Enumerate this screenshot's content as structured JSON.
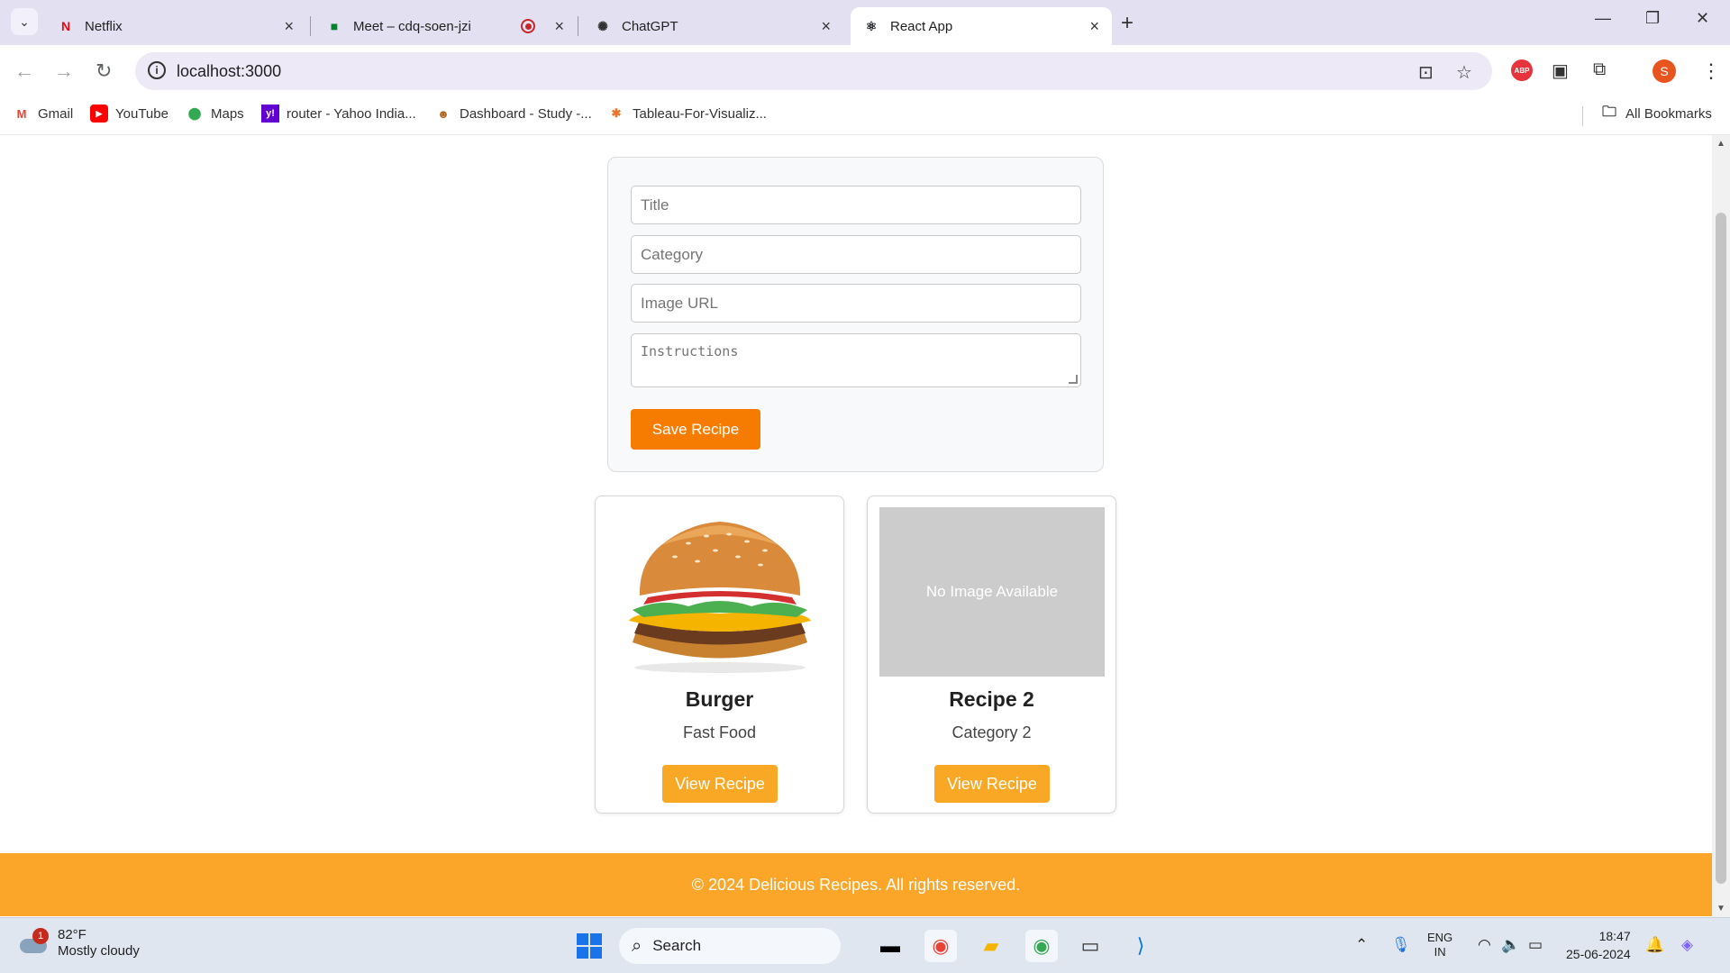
{
  "browser": {
    "tabs": [
      {
        "title": "Netflix",
        "icon": "netflix-icon"
      },
      {
        "title": "Meet – cdq-soen-jzi",
        "icon": "meet-icon"
      },
      {
        "title": "ChatGPT",
        "icon": "chatgpt-icon"
      },
      {
        "title": "React App",
        "icon": "react-icon"
      }
    ],
    "url": "localhost:3000",
    "profile_initial": "S",
    "abp_label": "ABP"
  },
  "bookmarks": {
    "items": [
      {
        "label": "Gmail",
        "icon": "gmail-icon"
      },
      {
        "label": "YouTube",
        "icon": "youtube-icon"
      },
      {
        "label": "Maps",
        "icon": "maps-icon"
      },
      {
        "label": "router - Yahoo India...",
        "icon": "yahoo-icon"
      },
      {
        "label": "Dashboard - Study -...",
        "icon": "study-icon"
      },
      {
        "label": "Tableau-For-Visualiz...",
        "icon": "tableau-icon"
      }
    ],
    "all_label": "All Bookmarks"
  },
  "form": {
    "title_placeholder": "Title",
    "category_placeholder": "Category",
    "image_placeholder": "Image URL",
    "instructions_placeholder": "Instructions",
    "save_label": "Save Recipe"
  },
  "recipes": [
    {
      "title": "Burger",
      "category": "Fast Food",
      "button": "View Recipe",
      "image": "burger"
    },
    {
      "title": "Recipe 2",
      "category": "Category 2",
      "button": "View Recipe",
      "image_placeholder": "No Image Available"
    }
  ],
  "footer": {
    "text": "© 2024 Delicious Recipes. All rights reserved."
  },
  "taskbar": {
    "weather_temp": "82°F",
    "weather_desc": "Mostly cloudy",
    "weather_badge": "1",
    "search_label": "Search",
    "lang_top": "ENG",
    "lang_bottom": "IN",
    "time": "18:47",
    "date": "25-06-2024"
  },
  "colors": {
    "accent": "#f57c00",
    "button": "#f9a825",
    "footer": "#fba629"
  }
}
